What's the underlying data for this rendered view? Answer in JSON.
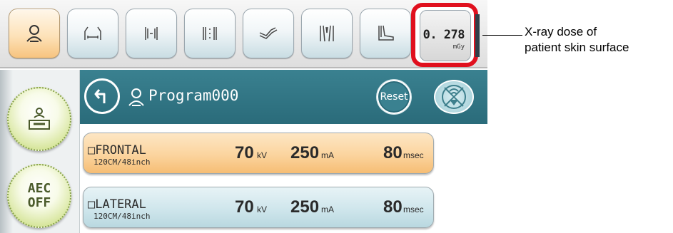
{
  "toolbar": {
    "buttons": [
      {
        "icon": "person-icon",
        "active": true
      },
      {
        "icon": "chest-frontal-icon",
        "active": false
      },
      {
        "icon": "pelvis-icon",
        "active": false
      },
      {
        "icon": "spine-icon",
        "active": false
      },
      {
        "icon": "arm-icon",
        "active": false
      },
      {
        "icon": "legs-icon",
        "active": false
      },
      {
        "icon": "foot-icon",
        "active": false
      }
    ],
    "dose": {
      "value": "0. 278",
      "unit": "mGy"
    },
    "accent_active": "#f7c47f",
    "highlight_color": "#e0101e"
  },
  "left_panel": {
    "table_button_icon": "patient-table-icon",
    "aec_button": {
      "line1": "AEC",
      "line2": "OFF"
    }
  },
  "program_bar": {
    "back_icon": "back-arrow-icon",
    "program_icon": "person-icon",
    "program_name": "Program000",
    "reset_label": "Reset",
    "nofluoro_icon": "no-fluoroscopy-icon",
    "color": "#2a6b7a"
  },
  "exposures": [
    {
      "name": "□FRONTAL",
      "sid": "120CM/48inch",
      "kv": "70",
      "kv_unit": "kV",
      "ma": "250",
      "ma_unit": "mA",
      "time": "80",
      "time_unit": "msec"
    },
    {
      "name": "□LATERAL",
      "sid": "120CM/48inch",
      "kv": "70",
      "kv_unit": "kV",
      "ma": "250",
      "ma_unit": "mA",
      "time": "80",
      "time_unit": "msec"
    }
  ],
  "callout": {
    "line1": "X-ray dose of",
    "line2": "patient skin surface"
  }
}
